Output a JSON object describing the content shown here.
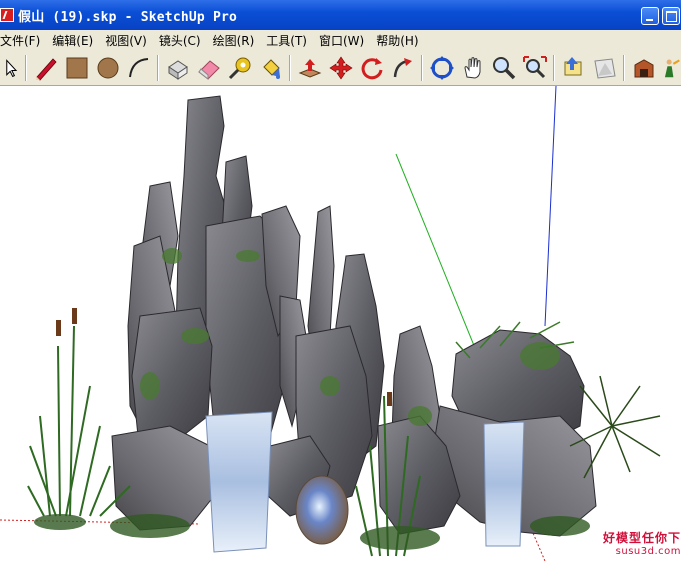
{
  "window": {
    "title": "假山 (19).skp - SketchUp Pro"
  },
  "menu": [
    "文件(F)",
    "编辑(E)",
    "视图(V)",
    "镜头(C)",
    "绘图(R)",
    "工具(T)",
    "窗口(W)",
    "帮助(H)"
  ],
  "toolbar": {
    "tools": [
      "select-tool",
      "line-tool",
      "rectangle-tool",
      "circle-tool",
      "arc-tool",
      "make-component-tool",
      "eraser-tool",
      "tape-measure-tool",
      "paint-bucket-tool",
      "push-pull-tool",
      "move-tool",
      "rotate-tool",
      "follow-me-tool",
      "orbit-tool",
      "pan-tool",
      "zoom-tool",
      "zoom-extents-tool",
      "previous-view-tool",
      "next-view-tool",
      "get-models-tool",
      "share-model-tool"
    ]
  },
  "colors": {
    "titlebar": "#0a4fd6",
    "chrome": "#ece9d8",
    "axis_blue": "#1a2fd0",
    "axis_green": "#22b022",
    "axis_red": "#d42020",
    "rock": "#6b6b70",
    "plant": "#2e6a22"
  },
  "watermark": {
    "cn": "好模型任你下",
    "url": "susu3d.com"
  }
}
